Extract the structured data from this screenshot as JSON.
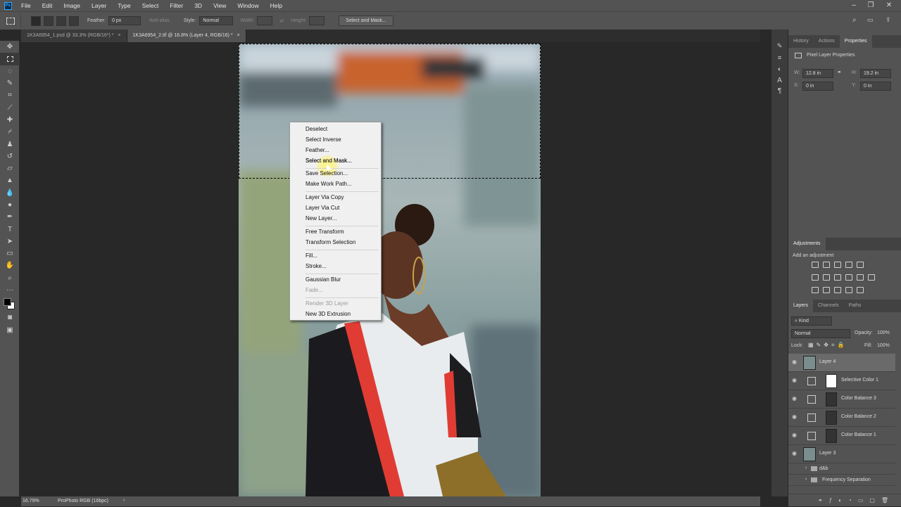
{
  "app": {
    "menu": [
      "File",
      "Edit",
      "Image",
      "Layer",
      "Type",
      "Select",
      "Filter",
      "3D",
      "View",
      "Window",
      "Help"
    ]
  },
  "options": {
    "feather_label": "Feather:",
    "feather_value": "0 px",
    "antialias_label": "Anti-alias",
    "style_label": "Style:",
    "style_value": "Normal",
    "width_label": "Width:",
    "height_label": "Height:",
    "select_mask_button": "Select and Mask..."
  },
  "tabs": [
    {
      "label": "1K3A6954_1.psd @ 33.3% (RGB/16*) *"
    },
    {
      "label": "1K3A6954_2.tif @ 16.8% (Layer 4, RGB/16) *"
    }
  ],
  "context_menu": {
    "items": [
      {
        "label": "Deselect"
      },
      {
        "label": "Select Inverse"
      },
      {
        "label": "Feather..."
      },
      {
        "label": "Select and Mask..."
      },
      {
        "label": "Save Selection..."
      },
      {
        "label": "Make Work Path..."
      },
      {
        "label": "Layer Via Copy"
      },
      {
        "label": "Layer Via Cut"
      },
      {
        "label": "New Layer..."
      },
      {
        "label": "Free Transform"
      },
      {
        "label": "Transform Selection"
      },
      {
        "label": "Fill..."
      },
      {
        "label": "Stroke..."
      },
      {
        "label": "Gaussian Blur"
      },
      {
        "label": "Fade..."
      },
      {
        "label": "Render 3D Layer"
      },
      {
        "label": "New 3D Extrusion"
      }
    ]
  },
  "status": {
    "zoom": "16.79%",
    "profile": "ProPhoto RGB (16bpc)"
  },
  "properties_panel": {
    "tabs": [
      "History",
      "Actions",
      "Properties"
    ],
    "title": "Pixel Layer Properties",
    "w_label": "W:",
    "w_value": "12.8 in",
    "h_label": "H:",
    "h_value": "19.2 in",
    "x_label": "X:",
    "x_value": "0 in",
    "y_label": "Y:",
    "y_value": "0 in"
  },
  "adjustments_panel": {
    "title": "Adjustments",
    "subtitle": "Add an adjustment"
  },
  "layers_panel": {
    "tabs": [
      "Layers",
      "Channels",
      "Paths"
    ],
    "filter_value": "Kind",
    "blend_mode": "Normal",
    "opacity_label": "Opacity:",
    "opacity_value": "100%",
    "lock_label": "Lock:",
    "fill_label": "Fill:",
    "fill_value": "100%",
    "layers": [
      {
        "name": "Layer 4"
      },
      {
        "name": "Selective Color 1"
      },
      {
        "name": "Color Balance 3"
      },
      {
        "name": "Color Balance 2"
      },
      {
        "name": "Color Balance 1"
      },
      {
        "name": "Layer 3"
      },
      {
        "name": "d&b"
      },
      {
        "name": "Frequency Separation"
      }
    ]
  },
  "colors": {
    "accent": "#31a8ff",
    "panel": "#535353",
    "menu_highlight": "#fff36b"
  }
}
